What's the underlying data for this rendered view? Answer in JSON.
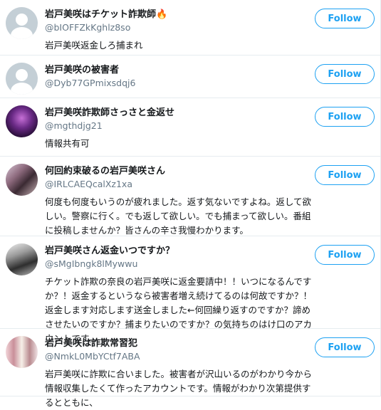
{
  "follow_label": "Follow",
  "users": [
    {
      "name": "岩戸美咲はチケット詐欺師",
      "name_emoji": "🔥",
      "handle": "@bIOFFZkKghlz8so",
      "bio": "岩戸美咲返金しろ捕まれ",
      "avatar": "default"
    },
    {
      "name": "岩戸美咲の被害者",
      "name_emoji": "",
      "handle": "@Dyb77GPmixsdqj6",
      "bio": "",
      "avatar": "default"
    },
    {
      "name": "岩戸美咲詐欺師さっさと金返せ",
      "name_emoji": "",
      "handle": "@mgthdjg21",
      "bio": "情報共有可",
      "avatar": "photo-purple"
    },
    {
      "name": "何回約束破るの岩戸美咲さん",
      "name_emoji": "",
      "handle": "@IRLCAEQcalXz1xa",
      "bio": "何度も何度もいうのが疲れました。返す気ないですよね。返して欲しい。警察に行く。でも返して欲しい。でも捕まって欲しい。番組に投稿しませんか？皆さんの辛さ我慢わかります。",
      "avatar": "photo-couple"
    },
    {
      "name": "岩戸美咲さん返金いつですか？",
      "name_emoji": "",
      "handle": "@sMgIbngk8lMywwu",
      "bio": "チケット詐欺の奈良の岩戸美咲に返金要請中！！いつになるんですか？！返金するというなら被害者増え続けてるのは何故ですか？！返金します対応します送金しました←何回繰り返すのですか？諦めさせたいのですか？捕まりたいのですか？の気持ちのはけ口のアカウントです。",
      "avatar": "photo-bw"
    },
    {
      "name": "岩戸美咲は詐欺常習犯",
      "name_emoji": "",
      "handle": "@NmkL0MbYCtf7ABA",
      "bio": "岩戸美咲に詐欺に合いました。被害者が沢山いるのがわかり今から情報収集したくて作ったアカウントです。情報がわかり次第提供するとともに、",
      "avatar": "photo-group"
    }
  ]
}
